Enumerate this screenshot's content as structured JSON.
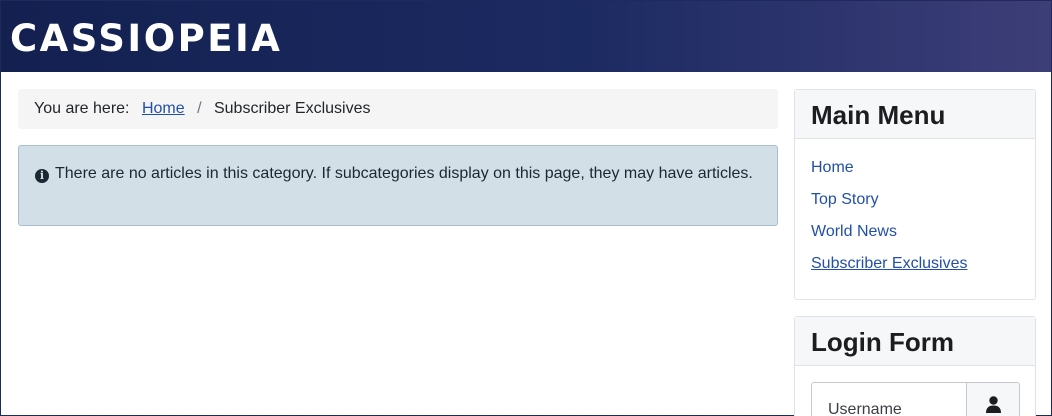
{
  "header": {
    "brand": "CASSIOPEIA"
  },
  "breadcrumb": {
    "prefix": "You are here:",
    "items": [
      "Home",
      "Subscriber Exclusives"
    ],
    "separator": "/"
  },
  "alert": {
    "icon": "info-circle-icon",
    "message": "There are no articles in this category. If subcategories display on this page, they may have articles."
  },
  "main_menu": {
    "title": "Main Menu",
    "items": [
      {
        "label": "Home"
      },
      {
        "label": "Top Story"
      },
      {
        "label": "World News"
      },
      {
        "label": "Subscriber Exclusives"
      }
    ]
  },
  "login_form": {
    "title": "Login Form",
    "username_placeholder": "Username",
    "user_icon": "user-icon"
  },
  "colors": {
    "header_start": "#132050",
    "header_end": "#3d3e78",
    "link": "#224faa",
    "alert_bg": "#d3dfe7"
  }
}
